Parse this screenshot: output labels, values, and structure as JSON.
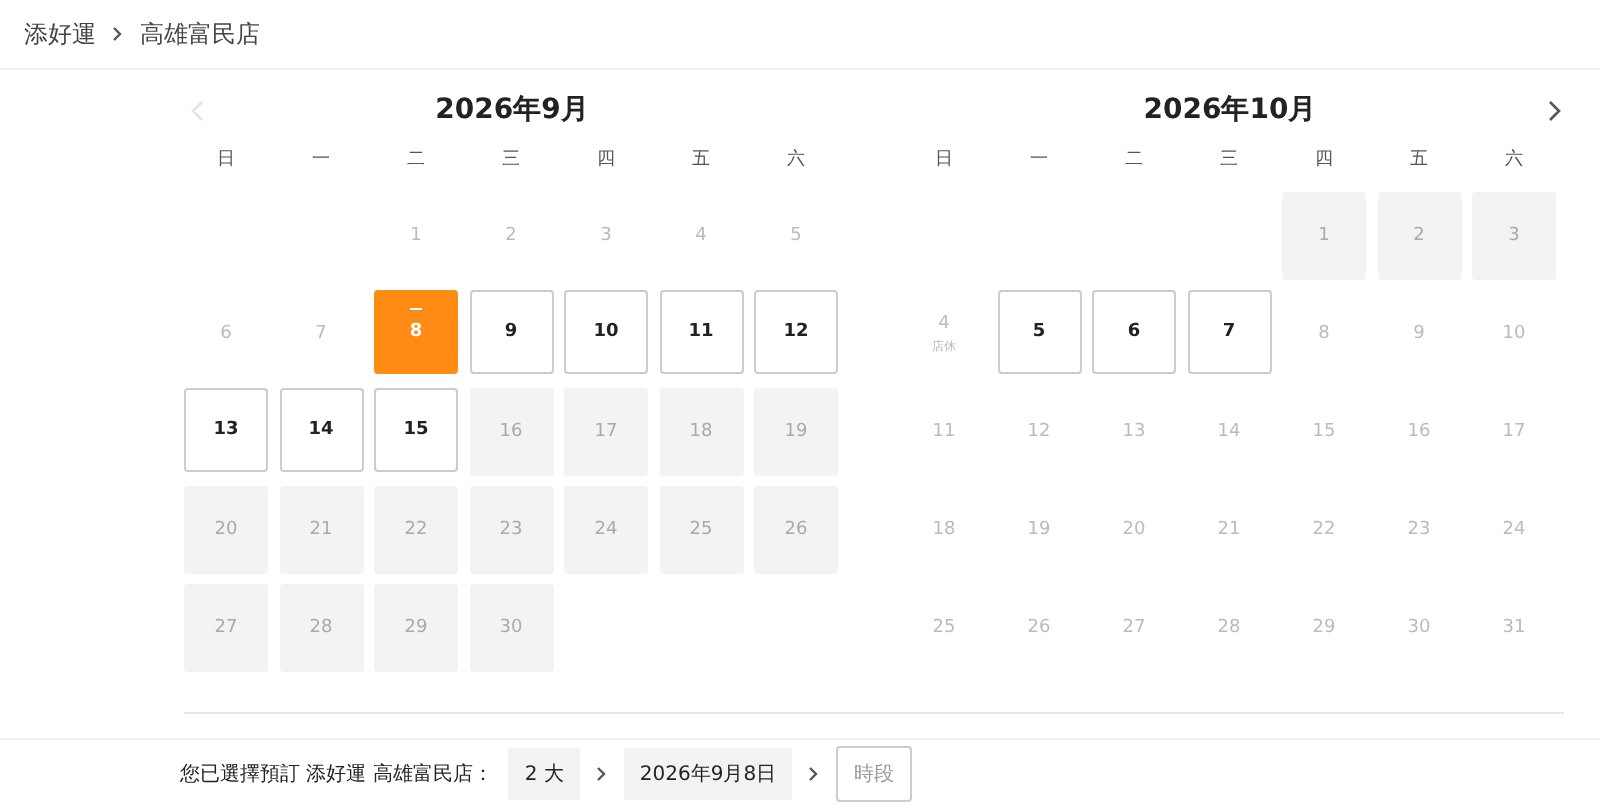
{
  "breadcrumb": [
    {
      "label": "添好運"
    },
    {
      "label": "高雄富民店"
    }
  ],
  "nav": {
    "prev_disabled": true,
    "next_disabled": false
  },
  "months": [
    {
      "title": "2026年9月",
      "weekdays": [
        "日",
        "一",
        "二",
        "三",
        "四",
        "五",
        "六"
      ],
      "days": [
        {
          "kind": "blank"
        },
        {
          "kind": "blank"
        },
        {
          "label": "1",
          "kind": "closed",
          "selected": false
        },
        {
          "label": "2",
          "kind": "closed",
          "selected": false
        },
        {
          "label": "3",
          "kind": "closed",
          "selected": false
        },
        {
          "label": "4",
          "kind": "closed",
          "selected": false
        },
        {
          "label": "5",
          "kind": "closed",
          "selected": false
        },
        {
          "label": "6",
          "kind": "closed",
          "selected": false
        },
        {
          "label": "7",
          "kind": "closed",
          "selected": false
        },
        {
          "label": "8",
          "kind": "available",
          "selected": true,
          "today": true
        },
        {
          "label": "9",
          "kind": "available",
          "selected": false
        },
        {
          "label": "10",
          "kind": "available",
          "selected": false
        },
        {
          "label": "11",
          "kind": "available",
          "selected": false
        },
        {
          "label": "12",
          "kind": "available",
          "selected": false
        },
        {
          "label": "13",
          "kind": "available",
          "selected": false
        },
        {
          "label": "14",
          "kind": "available",
          "selected": false
        },
        {
          "label": "15",
          "kind": "available",
          "selected": false
        },
        {
          "label": "16",
          "kind": "full",
          "selected": false
        },
        {
          "label": "17",
          "kind": "full",
          "selected": false
        },
        {
          "label": "18",
          "kind": "full",
          "selected": false
        },
        {
          "label": "19",
          "kind": "full",
          "selected": false
        },
        {
          "label": "20",
          "kind": "full",
          "selected": false
        },
        {
          "label": "21",
          "kind": "full",
          "selected": false
        },
        {
          "label": "22",
          "kind": "full",
          "selected": false
        },
        {
          "label": "23",
          "kind": "full",
          "selected": false
        },
        {
          "label": "24",
          "kind": "full",
          "selected": false
        },
        {
          "label": "25",
          "kind": "full",
          "selected": false
        },
        {
          "label": "26",
          "kind": "full",
          "selected": false
        },
        {
          "label": "27",
          "kind": "full",
          "selected": false
        },
        {
          "label": "28",
          "kind": "full",
          "selected": false
        },
        {
          "label": "29",
          "kind": "full",
          "selected": false
        },
        {
          "label": "30",
          "kind": "full",
          "selected": false
        }
      ]
    },
    {
      "title": "2026年10月",
      "weekdays": [
        "日",
        "一",
        "二",
        "三",
        "四",
        "五",
        "六"
      ],
      "days": [
        {
          "kind": "blank"
        },
        {
          "kind": "blank"
        },
        {
          "kind": "blank"
        },
        {
          "kind": "blank"
        },
        {
          "label": "1",
          "kind": "full",
          "selected": false
        },
        {
          "label": "2",
          "kind": "full",
          "selected": false
        },
        {
          "label": "3",
          "kind": "full",
          "selected": false
        },
        {
          "label": "4",
          "kind": "closed",
          "selected": false,
          "note": "店休"
        },
        {
          "label": "5",
          "kind": "available",
          "selected": false
        },
        {
          "label": "6",
          "kind": "available",
          "selected": false
        },
        {
          "label": "7",
          "kind": "available",
          "selected": false
        },
        {
          "label": "8",
          "kind": "closed",
          "selected": false
        },
        {
          "label": "9",
          "kind": "closed",
          "selected": false
        },
        {
          "label": "10",
          "kind": "closed",
          "selected": false
        },
        {
          "label": "11",
          "kind": "closed",
          "selected": false
        },
        {
          "label": "12",
          "kind": "closed",
          "selected": false
        },
        {
          "label": "13",
          "kind": "closed",
          "selected": false
        },
        {
          "label": "14",
          "kind": "closed",
          "selected": false
        },
        {
          "label": "15",
          "kind": "closed",
          "selected": false
        },
        {
          "label": "16",
          "kind": "closed",
          "selected": false
        },
        {
          "label": "17",
          "kind": "closed",
          "selected": false
        },
        {
          "label": "18",
          "kind": "closed",
          "selected": false
        },
        {
          "label": "19",
          "kind": "closed",
          "selected": false
        },
        {
          "label": "20",
          "kind": "closed",
          "selected": false
        },
        {
          "label": "21",
          "kind": "closed",
          "selected": false
        },
        {
          "label": "22",
          "kind": "closed",
          "selected": false
        },
        {
          "label": "23",
          "kind": "closed",
          "selected": false
        },
        {
          "label": "24",
          "kind": "closed",
          "selected": false
        },
        {
          "label": "25",
          "kind": "closed",
          "selected": false
        },
        {
          "label": "26",
          "kind": "closed",
          "selected": false
        },
        {
          "label": "27",
          "kind": "closed",
          "selected": false
        },
        {
          "label": "28",
          "kind": "closed",
          "selected": false
        },
        {
          "label": "29",
          "kind": "closed",
          "selected": false
        },
        {
          "label": "30",
          "kind": "closed",
          "selected": false
        },
        {
          "label": "31",
          "kind": "closed",
          "selected": false
        }
      ]
    }
  ],
  "summary": {
    "text": "您已選擇預訂 添好運 高雄富民店：",
    "steps": [
      {
        "label": "2 大",
        "kind": "chip"
      },
      {
        "label": "2026年9月8日",
        "kind": "chip"
      },
      {
        "label": "時段",
        "kind": "button"
      }
    ]
  }
}
